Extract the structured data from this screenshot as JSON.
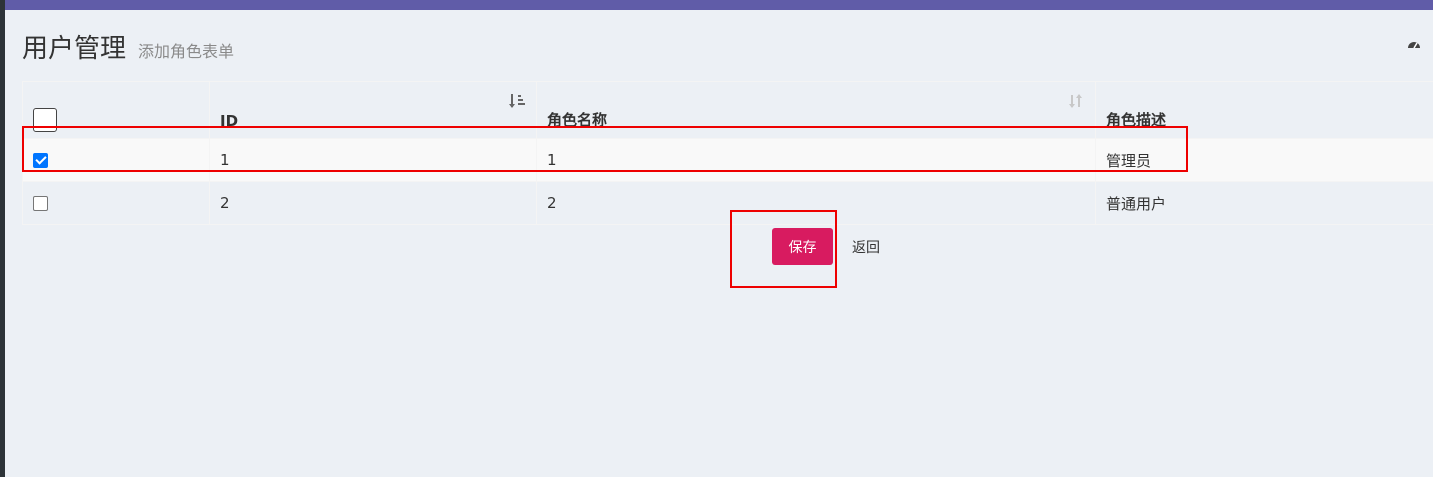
{
  "header": {
    "title": "用户管理",
    "subtitle": "添加角色表单",
    "dashboard_icon": "dashboard-icon"
  },
  "table": {
    "columns": [
      {
        "label": "",
        "sortable": false
      },
      {
        "label": "ID",
        "sortable": true,
        "sort_state": "desc"
      },
      {
        "label": "角色名称",
        "sortable": true,
        "sort_state": "none"
      },
      {
        "label": "角色描述",
        "sortable": false
      }
    ],
    "rows": [
      {
        "checked": true,
        "id": "1",
        "name": "1",
        "desc": "管理员"
      },
      {
        "checked": false,
        "id": "2",
        "name": "2",
        "desc": "普通用户"
      }
    ]
  },
  "actions": {
    "save_label": "保存",
    "back_label": "返回"
  },
  "colors": {
    "top_bar": "#605ca8",
    "save_button": "#d81b60",
    "highlight": "#e00000",
    "checkbox_checked": "#0075ff"
  }
}
